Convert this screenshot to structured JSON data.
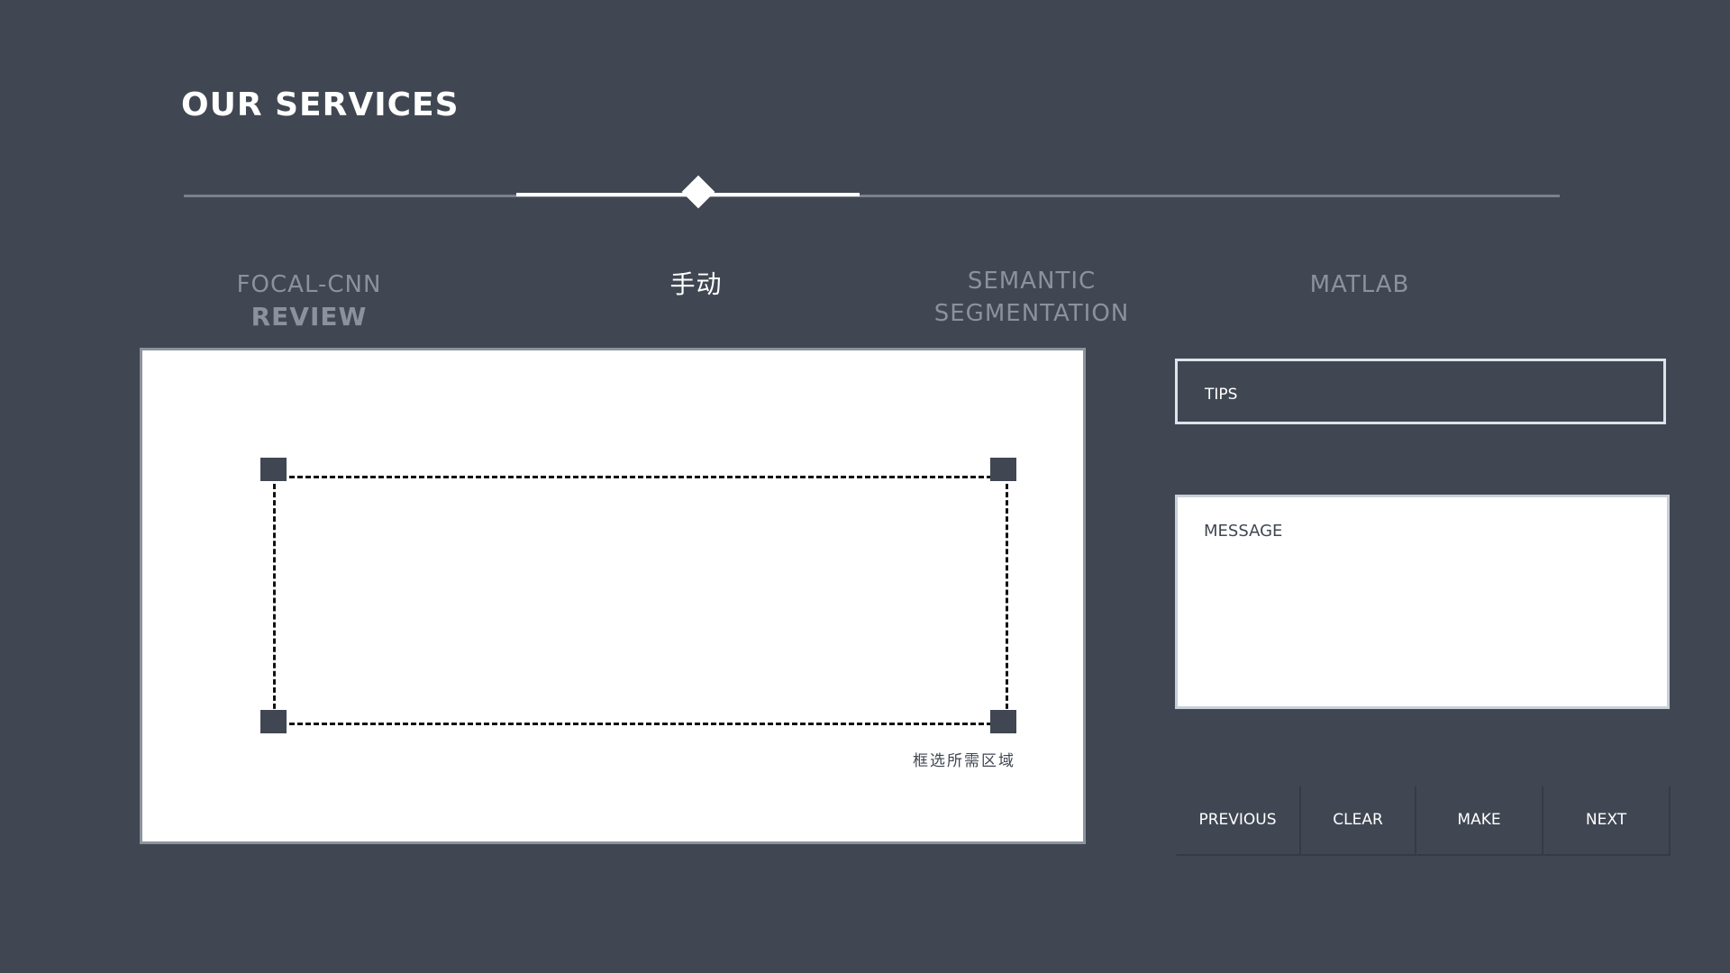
{
  "header": {
    "title": "OUR SERVICES"
  },
  "slider": {
    "value_percent": 37.5
  },
  "tabs": [
    {
      "line1": "FOCAL-CNN",
      "line2": "REVIEW",
      "active": false
    },
    {
      "line1": "手动",
      "active": true
    },
    {
      "line1": "SEMANTIC",
      "line2": "SEGMENTATION",
      "active": false
    },
    {
      "line1": "MATLAB",
      "active": false
    }
  ],
  "canvas": {
    "hint": "框选所需区域"
  },
  "tips": {
    "label": "TIPS"
  },
  "message": {
    "label": "MESSAGE"
  },
  "buttons": {
    "previous": "PREVIOUS",
    "clear": "CLEAR",
    "make": "MAKE",
    "next": "NEXT"
  },
  "colors": {
    "background": "#404752",
    "accent": "#ffffff",
    "muted_text": "#8b929c"
  }
}
